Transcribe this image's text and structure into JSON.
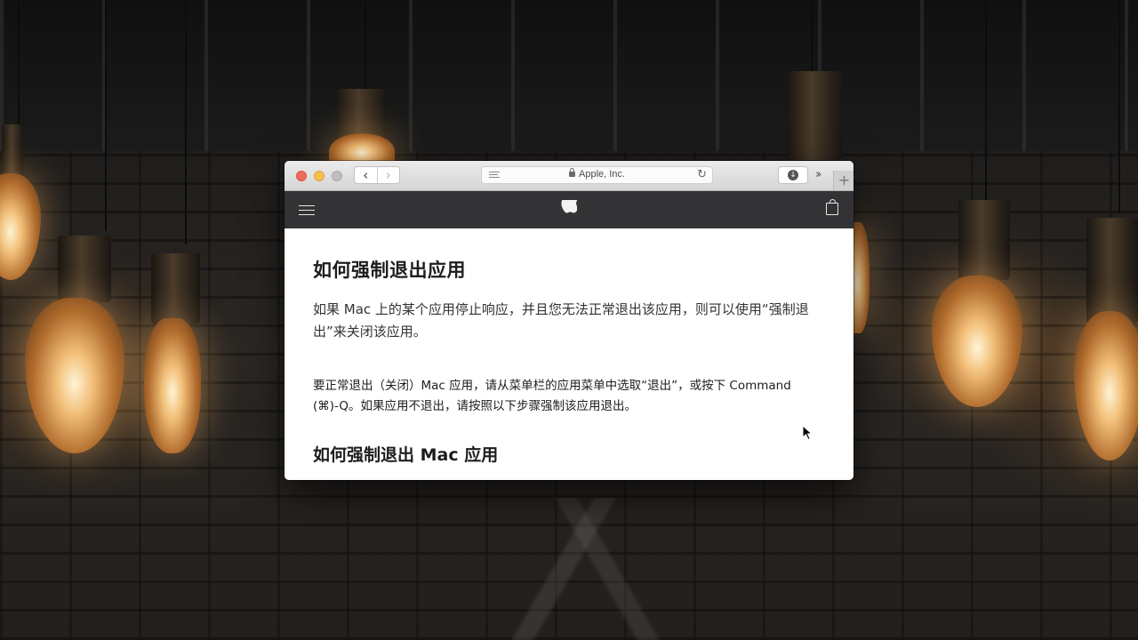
{
  "browser": {
    "address_text": "Apple, Inc.",
    "back_glyph": "‹",
    "forward_glyph": "›",
    "reload_glyph": "↻",
    "download_glyph": "↓",
    "more_glyph": "››",
    "newtab_glyph": "+"
  },
  "article": {
    "title": "如何强制退出应用",
    "intro": "如果 Mac 上的某个应用停止响应，并且您无法正常退出该应用，则可以使用“强制退出”来关闭该应用。",
    "paragraph": "要正常退出（关闭）Mac 应用，请从菜单栏的应用菜单中选取“退出”，或按下 Command (⌘)-Q。如果应用不退出，请按照以下步骤强制该应用退出。",
    "subtitle": "如何强制退出 Mac 应用"
  },
  "colors": {
    "close": "#ee6a5f",
    "minimize": "#f5bf4f",
    "maximize": "#bfbfbf",
    "site_nav": "#333336"
  },
  "icons": [
    "reader-icon",
    "lock-icon",
    "reload-icon",
    "download-icon",
    "more-icon",
    "hamburger-icon",
    "apple-logo-icon",
    "bag-icon",
    "cursor-icon"
  ]
}
